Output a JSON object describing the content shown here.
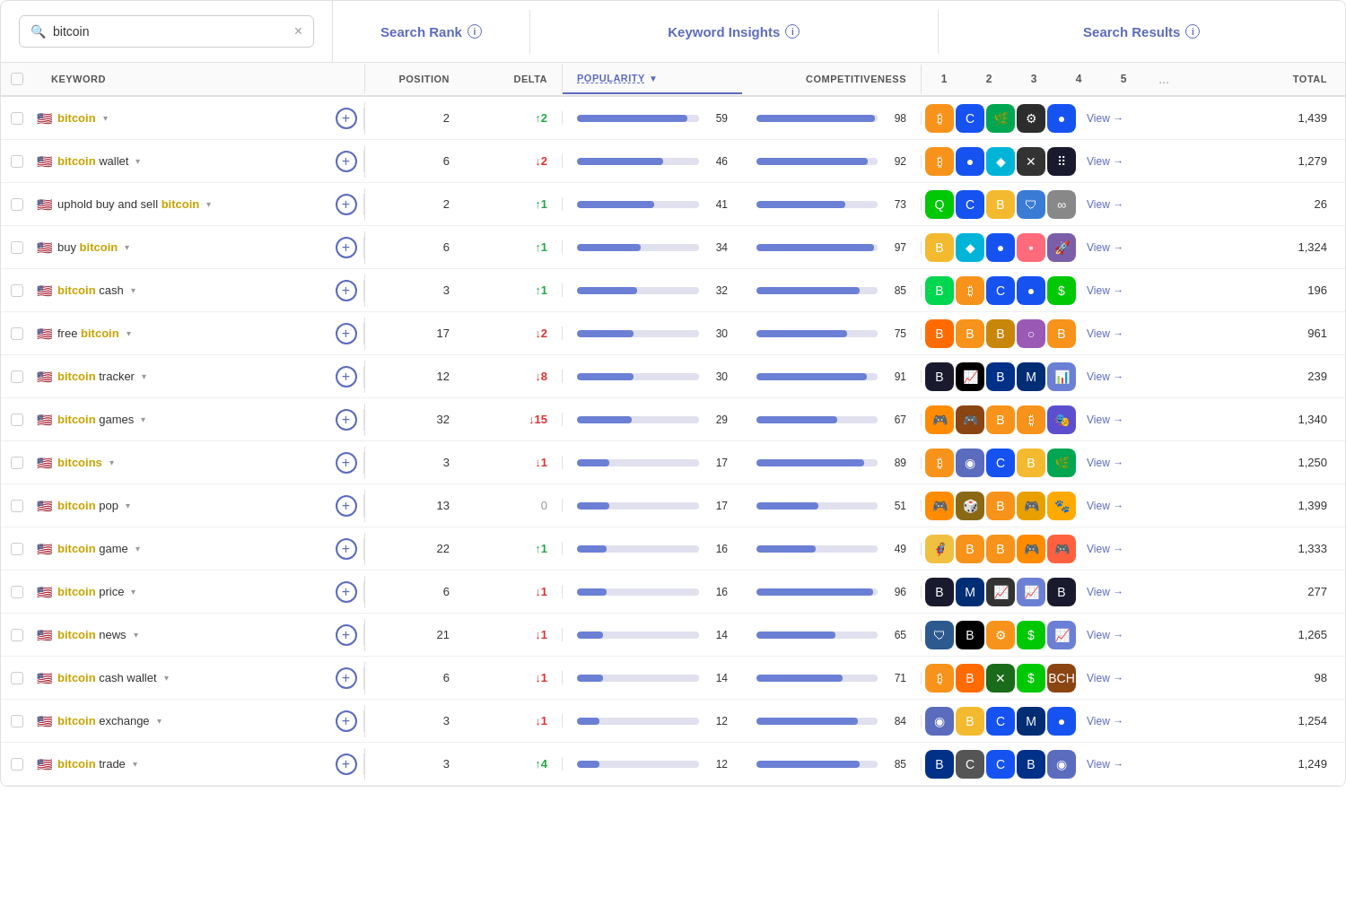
{
  "search": {
    "value": "bitcoin",
    "placeholder": "bitcoin"
  },
  "sections": {
    "rank": "Search Rank",
    "insights": "Keyword Insights",
    "results": "Search Results"
  },
  "columns": {
    "keyword": "KEYWORD",
    "position": "POSITION",
    "delta": "DELTA",
    "popularity": "POPULARITY",
    "competitiveness": "COMPETITIVENESS",
    "result_nums": [
      "1",
      "2",
      "3",
      "4",
      "5"
    ],
    "dots": "...",
    "total": "TOTAL"
  },
  "rows": [
    {
      "keyword": "bitcoin",
      "highlight": "bitcoin",
      "suffix": "",
      "flag": "🇺🇸",
      "position": 2,
      "delta": 2,
      "delta_dir": "up",
      "popularity": 59,
      "competitiveness": 98,
      "total": "1,439"
    },
    {
      "keyword": "bitcoin wallet",
      "highlight": "bitcoin",
      "suffix": " wallet",
      "flag": "🇺🇸",
      "position": 6,
      "delta": 2,
      "delta_dir": "down",
      "popularity": 46,
      "competitiveness": 92,
      "total": "1,279"
    },
    {
      "keyword": "uphold buy and sell bitcoin",
      "highlight": "bitcoin",
      "prefix": "uphold buy and sell ",
      "suffix": "",
      "flag": "🇺🇸",
      "position": 2,
      "delta": 1,
      "delta_dir": "up",
      "popularity": 41,
      "competitiveness": 73,
      "total": "26"
    },
    {
      "keyword": "buy bitcoin",
      "highlight": "bitcoin",
      "prefix": "buy ",
      "suffix": "",
      "flag": "🇺🇸",
      "position": 6,
      "delta": 1,
      "delta_dir": "up",
      "popularity": 34,
      "competitiveness": 97,
      "total": "1,324"
    },
    {
      "keyword": "bitcoin cash",
      "highlight": "bitcoin",
      "suffix": " cash",
      "flag": "🇺🇸",
      "position": 3,
      "delta": 1,
      "delta_dir": "up",
      "popularity": 32,
      "competitiveness": 85,
      "total": "196"
    },
    {
      "keyword": "free bitcoin",
      "highlight": "bitcoin",
      "prefix": "free ",
      "suffix": "",
      "flag": "🇺🇸",
      "position": 17,
      "delta": 2,
      "delta_dir": "down",
      "popularity": 30,
      "competitiveness": 75,
      "total": "961"
    },
    {
      "keyword": "bitcoin tracker",
      "highlight": "bitcoin",
      "suffix": " tracker",
      "flag": "🇺🇸",
      "position": 12,
      "delta": 8,
      "delta_dir": "down",
      "popularity": 30,
      "competitiveness": 91,
      "total": "239"
    },
    {
      "keyword": "bitcoin games",
      "highlight": "bitcoin",
      "suffix": " games",
      "flag": "🇺🇸",
      "position": 32,
      "delta": 15,
      "delta_dir": "down",
      "popularity": 29,
      "competitiveness": 67,
      "total": "1,340"
    },
    {
      "keyword": "bitcoins",
      "highlight": "bitcoins",
      "suffix": "",
      "prefix": "",
      "flag": "🇺🇸",
      "position": 3,
      "delta": 1,
      "delta_dir": "down",
      "popularity": 17,
      "competitiveness": 89,
      "total": "1,250"
    },
    {
      "keyword": "bitcoin pop",
      "highlight": "bitcoin",
      "suffix": " pop",
      "flag": "🇺🇸",
      "position": 13,
      "delta": 0,
      "delta_dir": "zero",
      "popularity": 17,
      "competitiveness": 51,
      "total": "1,399"
    },
    {
      "keyword": "bitcoin game",
      "highlight": "bitcoin",
      "suffix": " game",
      "flag": "🇺🇸",
      "position": 22,
      "delta": 1,
      "delta_dir": "up",
      "popularity": 16,
      "competitiveness": 49,
      "total": "1,333"
    },
    {
      "keyword": "bitcoin price",
      "highlight": "bitcoin",
      "suffix": " price",
      "flag": "🇺🇸",
      "position": 6,
      "delta": 1,
      "delta_dir": "down",
      "popularity": 16,
      "competitiveness": 96,
      "total": "277"
    },
    {
      "keyword": "bitcoin news",
      "highlight": "bitcoin",
      "suffix": " news",
      "flag": "🇺🇸",
      "position": 21,
      "delta": 1,
      "delta_dir": "down",
      "popularity": 14,
      "competitiveness": 65,
      "total": "1,265"
    },
    {
      "keyword": "bitcoin cash wallet",
      "highlight": "bitcoin",
      "suffix": " cash wallet",
      "flag": "🇺🇸",
      "position": 6,
      "delta": 1,
      "delta_dir": "down",
      "popularity": 14,
      "competitiveness": 71,
      "total": "98"
    },
    {
      "keyword": "bitcoin exchange",
      "highlight": "bitcoin",
      "suffix": " exchange",
      "flag": "🇺🇸",
      "position": 3,
      "delta": 1,
      "delta_dir": "down",
      "popularity": 12,
      "competitiveness": 84,
      "total": "1,254"
    },
    {
      "keyword": "bitcoin trade",
      "highlight": "bitcoin",
      "suffix": " trade",
      "flag": "🇺🇸",
      "position": 3,
      "delta": 4,
      "delta_dir": "up",
      "popularity": 12,
      "competitiveness": 85,
      "total": "1,249"
    }
  ]
}
